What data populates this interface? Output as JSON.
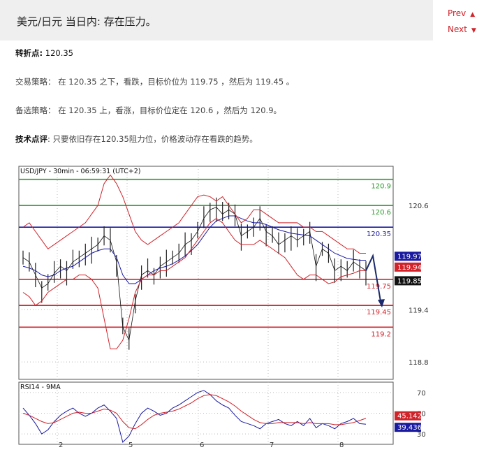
{
  "header": {
    "title": "美元/日元 当日内: 存在压力。",
    "prev_label": "Prev",
    "next_label": "Next"
  },
  "colors": {
    "accent_red": "#d0232a",
    "header_bg": "#efefef"
  },
  "analysis": {
    "pivot_label": "转折点:",
    "pivot_value": " 120.35",
    "strategy": "交易策略： 在 120.35 之下，看跌，目标价位为 119.75 ，然后为 119.45 。",
    "alternative": "备选策略： 在 120.35 上，看涨，目标价位定在 120.6 ，然后为 120.9。",
    "comment_label": "技术点评",
    "comment": ": 只要依旧存在120.35阻力位，价格波动存在看跌的趋势。"
  },
  "chart_data": [
    {
      "type": "line",
      "title": "USD/JPY - 30min - 06:59:31 (UTC+2)",
      "ylim": [
        118.6,
        121.05
      ],
      "y_ticks": [
        120.6,
        119.4,
        118.8
      ],
      "x_ticks": [
        "2",
        "5",
        "6",
        "7",
        "8"
      ],
      "levels": [
        {
          "value": 120.9,
          "label": "120.9",
          "color": "#2a9a2a"
        },
        {
          "value": 120.6,
          "label": "120.6",
          "color": "#2a9a2a"
        },
        {
          "value": 120.35,
          "label": "120.35",
          "color": "#1a1aa0"
        },
        {
          "value": 119.75,
          "label": "119.75",
          "color": "#d0232a"
        },
        {
          "value": 119.45,
          "label": "119.45",
          "color": "#d0232a"
        },
        {
          "value": 119.2,
          "label": "119.2",
          "color": "#d0232a"
        }
      ],
      "price_tags": [
        {
          "value": 119.971,
          "label": "119.971",
          "color": "#1a1aa0"
        },
        {
          "value": 119.943,
          "label": "119.943",
          "color": "#d0232a"
        },
        {
          "value": 119.85,
          "label": "119.85",
          "color": "#111111"
        }
      ],
      "series": [
        {
          "values": [
            120.0,
            119.95,
            119.8,
            119.65,
            119.7,
            119.82,
            119.9,
            119.85,
            119.95,
            120.0,
            120.05,
            120.1,
            120.15,
            120.25,
            120.2,
            119.95,
            119.2,
            119.05,
            119.5,
            119.8,
            119.85,
            119.8,
            119.9,
            119.95,
            120.0,
            120.05,
            120.15,
            120.2,
            120.3,
            120.45,
            120.55,
            120.58,
            120.5,
            120.55,
            120.5,
            120.25,
            120.3,
            120.35,
            120.45,
            120.3,
            120.25,
            120.15,
            120.2,
            120.25,
            120.2,
            120.25,
            120.3,
            119.9,
            120.1,
            120.05,
            119.85,
            119.9,
            119.85,
            119.95,
            119.9,
            119.85
          ]
        },
        {
          "values": [
            119.9,
            119.88,
            119.85,
            119.8,
            119.78,
            119.8,
            119.85,
            119.88,
            119.9,
            119.95,
            120.0,
            120.05,
            120.08,
            120.1,
            120.1,
            120.0,
            119.8,
            119.7,
            119.7,
            119.75,
            119.8,
            119.85,
            119.88,
            119.9,
            119.93,
            119.97,
            120.02,
            120.08,
            120.15,
            120.25,
            120.35,
            120.42,
            120.45,
            120.48,
            120.48,
            120.45,
            120.42,
            120.4,
            120.4,
            120.38,
            120.35,
            120.32,
            120.3,
            120.28,
            120.27,
            120.26,
            120.25,
            120.2,
            120.15,
            120.1,
            120.05,
            120.02,
            119.99,
            119.98,
            119.97,
            119.97
          ]
        },
        {
          "values": [
            120.35,
            120.4,
            120.3,
            120.2,
            120.1,
            120.15,
            120.2,
            120.25,
            120.3,
            120.35,
            120.4,
            120.5,
            120.6,
            120.85,
            120.95,
            120.85,
            120.7,
            120.5,
            120.3,
            120.2,
            120.15,
            120.2,
            120.25,
            120.3,
            120.35,
            120.4,
            120.5,
            120.6,
            120.7,
            120.72,
            120.7,
            120.65,
            120.7,
            120.6,
            120.5,
            120.4,
            120.45,
            120.55,
            120.55,
            120.5,
            120.45,
            120.4,
            120.4,
            120.4,
            120.4,
            120.35,
            120.35,
            120.3,
            120.3,
            120.25,
            120.2,
            120.15,
            120.1,
            120.1,
            120.05,
            120.05
          ]
        },
        {
          "values": [
            119.6,
            119.55,
            119.45,
            119.5,
            119.6,
            119.65,
            119.7,
            119.75,
            119.75,
            119.8,
            119.8,
            119.75,
            119.65,
            119.3,
            118.95,
            118.95,
            119.05,
            119.3,
            119.6,
            119.75,
            119.8,
            119.8,
            119.85,
            119.85,
            119.9,
            119.95,
            120.0,
            120.1,
            120.2,
            120.3,
            120.4,
            120.45,
            120.4,
            120.3,
            120.2,
            120.15,
            120.15,
            120.15,
            120.2,
            120.15,
            120.1,
            120.05,
            120.0,
            119.9,
            119.8,
            119.75,
            119.8,
            119.8,
            119.75,
            119.7,
            119.72,
            119.78,
            119.8,
            119.82,
            119.85,
            119.85
          ]
        }
      ]
    },
    {
      "type": "line",
      "title": "RSI14 - 9MA",
      "ylim": [
        20,
        80
      ],
      "y_ticks": [
        70,
        50,
        30
      ],
      "price_tags": [
        {
          "value": 45.142,
          "label": "45.142",
          "color": "#d0232a"
        },
        {
          "value": 39.436,
          "label": "39.436",
          "color": "#1a1aa0"
        }
      ],
      "series": [
        {
          "values": [
            55,
            48,
            40,
            30,
            34,
            42,
            48,
            52,
            55,
            50,
            47,
            50,
            55,
            58,
            52,
            45,
            22,
            28,
            40,
            50,
            55,
            52,
            48,
            50,
            55,
            58,
            62,
            66,
            70,
            72,
            68,
            62,
            58,
            55,
            48,
            42,
            40,
            38,
            35,
            40,
            42,
            44,
            40,
            38,
            42,
            38,
            45,
            36,
            40,
            38,
            35,
            40,
            42,
            45,
            40,
            39.4
          ]
        },
        {
          "values": [
            50,
            48,
            45,
            42,
            40,
            41,
            44,
            47,
            50,
            51,
            50,
            50,
            52,
            54,
            53,
            50,
            42,
            36,
            35,
            39,
            44,
            48,
            50,
            51,
            52,
            54,
            57,
            60,
            64,
            67,
            68,
            67,
            64,
            61,
            57,
            52,
            48,
            44,
            41,
            40,
            40,
            41,
            41,
            41,
            41,
            40,
            41,
            40,
            40,
            40,
            39,
            39,
            40,
            41,
            43,
            45.1
          ]
        }
      ]
    }
  ]
}
